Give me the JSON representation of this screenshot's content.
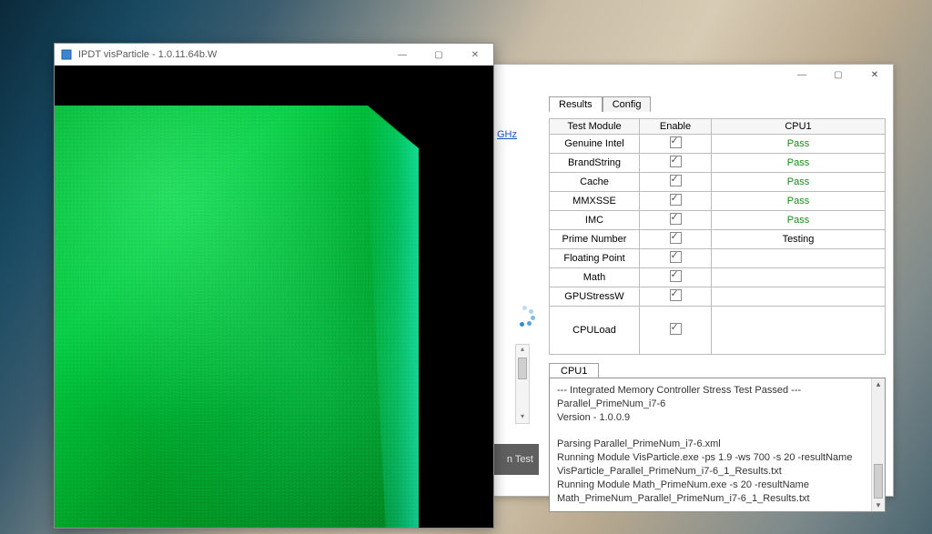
{
  "vis_window": {
    "title": "IPDT visParticle - 1.0.11.64b.W"
  },
  "diag_window": {
    "tabs": {
      "results": "Results",
      "config": "Config"
    },
    "table": {
      "headers": {
        "module": "Test  Module",
        "enable": "Enable",
        "cpu": "CPU1"
      },
      "rows": [
        {
          "module": "Genuine Intel",
          "result": "Pass",
          "result_class": "pass"
        },
        {
          "module": "BrandString",
          "result": "Pass",
          "result_class": "pass"
        },
        {
          "module": "Cache",
          "result": "Pass",
          "result_class": "pass"
        },
        {
          "module": "MMXSSE",
          "result": "Pass",
          "result_class": "pass"
        },
        {
          "module": "IMC",
          "result": "Pass",
          "result_class": "pass"
        },
        {
          "module": "Prime Number",
          "result": "Testing",
          "result_class": ""
        },
        {
          "module": "Floating Point",
          "result": "",
          "result_class": ""
        },
        {
          "module": "Math",
          "result": "",
          "result_class": ""
        },
        {
          "module": "GPUStressW",
          "result": "",
          "result_class": ""
        },
        {
          "module": "CPULoad",
          "result": "",
          "result_class": "",
          "tall": true
        }
      ]
    },
    "log": {
      "tab": "CPU1",
      "lines": [
        "--- Integrated Memory Controller Stress Test Passed ---",
        "Parallel_PrimeNum_i7-6",
        "Version - 1.0.0.9",
        "",
        "Parsing Parallel_PrimeNum_i7-6.xml",
        "Running Module VisParticle.exe -ps 1.9 -ws 700   -s 20 -resultName",
        "VisParticle_Parallel_PrimeNum_i7-6_1_Results.txt",
        "Running Module Math_PrimeNum.exe -s 20 -resultName",
        "Math_PrimeNum_Parallel_PrimeNum_i7-6_1_Results.txt"
      ]
    }
  },
  "fragments": {
    "ghz_link": "GHz",
    "stop_button_tail": "n Test"
  }
}
